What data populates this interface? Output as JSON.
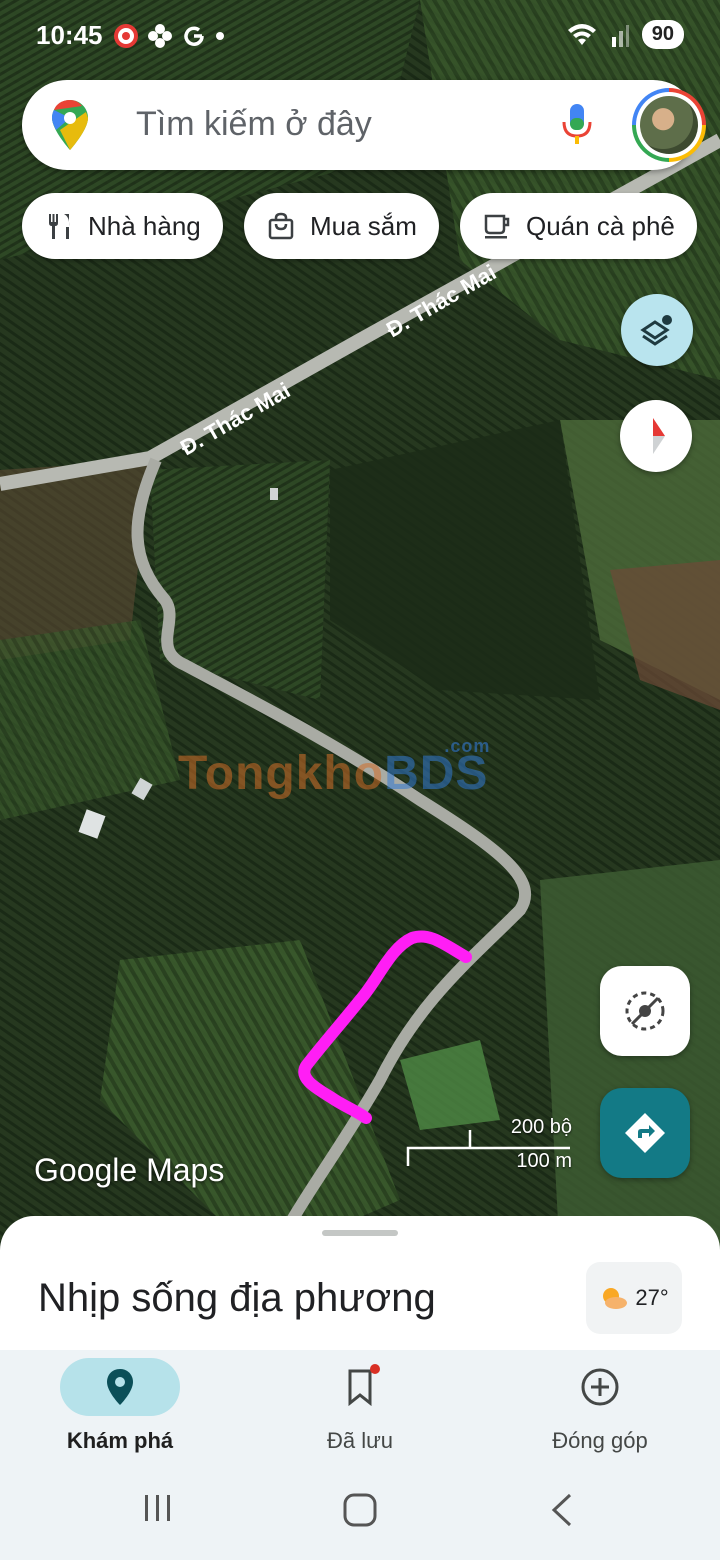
{
  "status_bar": {
    "time": "10:45",
    "battery": "90"
  },
  "search": {
    "placeholder": "Tìm kiếm ở đây"
  },
  "chips": [
    {
      "label": "Nhà hàng",
      "icon": "restaurant-icon"
    },
    {
      "label": "Mua sắm",
      "icon": "shopping-bag-icon"
    },
    {
      "label": "Quán cà phê",
      "icon": "coffee-icon"
    }
  ],
  "map": {
    "road_label_1": "Đ. Thác Mai",
    "road_label_2": "Đ. Thác Mai",
    "watermark_main": "Tongkho",
    "watermark_accent": "BDS",
    "watermark_suffix": ".com",
    "logo_google": "Google",
    "logo_maps": "Maps",
    "scale_imperial": "200 bộ",
    "scale_metric": "100 m",
    "highlight_color": "#ff1ef5"
  },
  "sheet": {
    "title": "Nhịp sống địa phương",
    "temperature": "27°"
  },
  "nav": {
    "items": [
      {
        "label": "Khám phá",
        "icon": "explore-pin-icon",
        "active": true
      },
      {
        "label": "Đã lưu",
        "icon": "bookmark-icon",
        "active": false
      },
      {
        "label": "Đóng góp",
        "icon": "add-circle-icon",
        "active": false
      }
    ]
  },
  "colors": {
    "accent": "#137a86",
    "nav_bg": "#eef3f6",
    "active_pill": "#b6e2ea"
  }
}
